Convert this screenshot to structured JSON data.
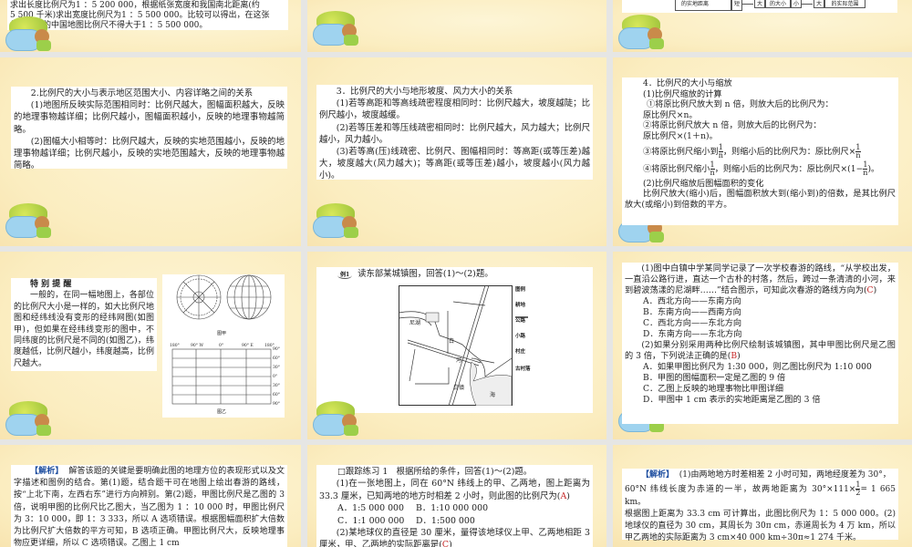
{
  "slides": {
    "s1": {
      "lines": [
        "求出长度比例尺为1 ：5 200 000，根据纸张宽度和我国南北距离(约",
        "5 500 千米)求出宽度比例尺为1 ：5 500 000。比较可以得出，在这张",
        "纸上绘制的中国地图比例尺不得大于1 ：5 500 000。"
      ]
    },
    "s3": {
      "diagram": [
        "的实地距离",
        "短",
        "大",
        "的大小",
        "小",
        "大",
        "的实际范围"
      ]
    },
    "s4": {
      "title": "2.比例尺的大小与表示地区范围大小、内容详略之间的关系",
      "p1": "(1)地图所反映实际范围相同时：比例尺越大，图幅面积越大，反映的地理事物越详细；比例尺越小，图幅面积越小，反映的地理事物越简略。",
      "p2": "(2)图幅大小相等时：比例尺越大，反映的实地范围越小，反映的地理事物越详细；比例尺越小，反映的实地范围越大，反映的地理事物越简略。"
    },
    "s5": {
      "title": "3．比例尺的大小与地形坡度、风力大小的关系",
      "p1": "(1)若等高距和等高线疏密程度相同时：比例尺越大，坡度越陡；比例尺越小，坡度越缓。",
      "p2": "(2)若等压差和等压线疏密相同时：比例尺越大，风力越大；比例尺越小，风力越小。",
      "p3": "(3)若等高(压)线疏密、比例尺、图幅相同时：等高距(或等压差)越大，坡度越大(风力越大)；等高距(或等压差)越小，坡度越小(风力越小)。"
    },
    "s6": {
      "title": "4．比例尺的大小与缩放",
      "sub1": "(1)比例尺缩放的计算",
      "l1": "①将原比例尺放大到 n 倍，则放大后的比例尺为：",
      "l2": "原比例尺×n。",
      "l3": "②将原比例尺放大 n 倍，则放大后的比例尺为：",
      "l4": "原比例尺×(1＋n)。",
      "l5a": "③将原比例尺缩小到",
      "l5b": "，则缩小后的比例尺为：原比例尺×",
      "l6a": "④将原比例尺缩小",
      "l6b": "，则缩小后的比例尺为：原比例尺×(1−",
      "l6c": ")。",
      "num": "1",
      "den": "n",
      "sub2": "(2)比例尺缩放后图幅面积的变化",
      "p": "比例尺放大(缩小)后，图幅面积放大到(缩小到)的倍数，是其比例尺放大(或缩小)到倍数的平方。"
    },
    "s7": {
      "title": "特 别 提 醒",
      "p": "一般的，在同一幅地图上，各部位的比例尺大小是一样的，如大比例尺地图和经纬线没有变形的经纬网图(如图甲)，但如果在经纬线变形的图中，不同纬度的比例尺是不同的(如图乙)，纬度越低，比例尺越小，纬度越高，比例尺越大。",
      "fig1": "图甲",
      "fig2": "图乙",
      "lon": [
        "180°",
        "90° W",
        "0°",
        "90° E",
        "180°"
      ],
      "lat": [
        "90°",
        "60°",
        "30°",
        "0°",
        "30°",
        "60°",
        "90°"
      ]
    },
    "s8": {
      "badge": "例1",
      "q": "读东部某城镇图，回答(1)～(2)题。",
      "map": [
        "尼湖",
        "白",
        "河",
        "白镇",
        "海"
      ],
      "legend": [
        "图例",
        "耕地",
        "公路",
        "小路",
        "村庄",
        "古村落"
      ]
    },
    "s9": {
      "q1": "(1)图中白镇中学某同学记录了一次学校春游的路线，“从学校出发，一直沿公路行进，直达一个古朴的村落，然后，跨过一条清清的小河，来到碧波荡漾的尼湖畔……”结合图示，可知此次春游的路线方向为(",
      "a1": "C",
      "opts1": [
        "A．西北方向——东南方向",
        "B．东南方向——西南方向",
        "C．西北方向——东北方向",
        "D．东南方向——东北方向"
      ],
      "q2": "(2)如果分别采用两种比例尺绘制该城镇图，其中甲图比例尺是乙图的 3 倍，下列说法正确的是(",
      "a2": "B",
      "opts2": [
        "A．如果甲图比例尺为 1:30 000，则乙图比例尺为 1:10 000",
        "B．甲图的图幅面积一定是乙图的 9 倍",
        "C．乙图上反映的地理事物比甲图详细",
        "D．甲图中 1 cm 表示的实地距离是乙图的 3 倍"
      ]
    },
    "s10": {
      "tag": "【解析】",
      "p": "解答该题的关键是要明确此图的地理方位的表现形式以及文字描述和图例的结合。第(1)题，结合题干可在地图上绘出春游的路线，按“上北下南，左西右东”进行方向辨别。第(2)题，甲图比例尺是乙图的 3 倍，说明甲图的比例尺比乙图大，当乙图为 1 ：10 000 时，甲图比例尺为 3：10 000，即 1：3 333，所以 A 选项错误。根据图幅面积扩大倍数为比例尺扩大倍数的平方可知，B 选项正确。甲图比例尺大，反映地理事物应更详细，所以 C 选项错误。乙图上 1 cm"
    },
    "s11": {
      "title": "□跟踪练习 1　根据所给的条件，回答(1)～(2)题。",
      "q1": "(1)在一张地图上，同在 60°N 纬线上的甲、乙两地，图上距离为 33.3 厘米，已知两地的地方时相差 2 小时，则此图的比例尺为(",
      "a1": "A",
      "optA": "A．1:5 000 000",
      "optB": "B．1:10 000 000",
      "optC": "C．1:1 000 000",
      "optD": "D．1:500 000",
      "q2": "(2)某地球仪的直径是 30 厘米，量得该地球仪上甲、乙两地相距 3 厘米，甲、乙两地的实际距离是(",
      "a2": "C"
    },
    "s12": {
      "tag": "【解析】",
      "l1": "(1)由两地地方时差相差 2 小时可知，两地经度差为 30°，",
      "l2a": "60°N 纬线长度为赤道的一半，故两地距离为 30°×111×",
      "l2b": "= 1 665 km。",
      "num": "1",
      "den": "2",
      "l3": "根据图上距离为 33.3 cm 可计算出，此图比例尺为 1：5 000 000。(2)地球仪的直径为 30 cm，其周长为 30π cm，赤道周长为 4 万 km，所以甲乙两地的实际距离为 3 cm×40 000 km÷30π≈1 274 千米。"
    }
  },
  "colors": {
    "answer": "#c62828",
    "tag": "#1f4fa0",
    "bg": "#fbedc0"
  }
}
